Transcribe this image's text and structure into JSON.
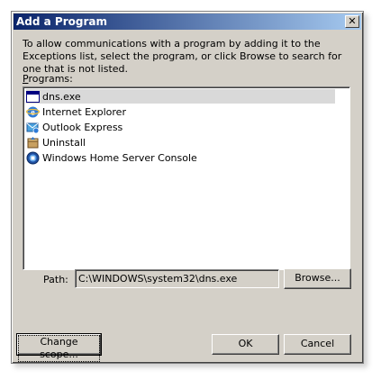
{
  "window": {
    "title": "Add a Program",
    "close_glyph": "✕"
  },
  "description": "To allow communications with a program by adding it to the Exceptions list, select the program, or click Browse to search for one that is not listed.",
  "programs": {
    "label": "Programs:",
    "items": [
      {
        "label": "dns.exe",
        "icon": "application-window-icon",
        "selected": true
      },
      {
        "label": "Internet Explorer",
        "icon": "internet-explorer-icon",
        "selected": false
      },
      {
        "label": "Outlook Express",
        "icon": "outlook-express-icon",
        "selected": false
      },
      {
        "label": "Uninstall",
        "icon": "uninstall-icon",
        "selected": false
      },
      {
        "label": "Windows Home Server Console",
        "icon": "windows-home-server-icon",
        "selected": false
      }
    ]
  },
  "path": {
    "label": "Path:",
    "value": "C:\\WINDOWS\\system32\\dns.exe"
  },
  "buttons": {
    "browse": "Browse...",
    "change_scope": "Change scope...",
    "ok": "OK",
    "cancel": "Cancel"
  },
  "colors": {
    "dialog_bg": "#d4d0c8",
    "title_start": "#0a246a",
    "title_end": "#a6caf0",
    "selected_row": "#d9d9d9"
  }
}
